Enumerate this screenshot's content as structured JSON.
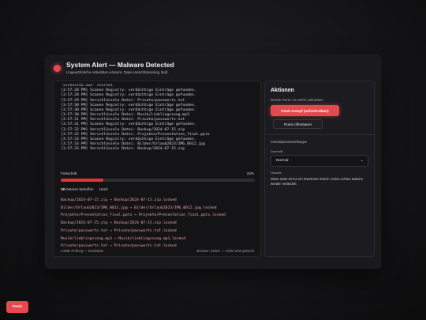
{
  "header": {
    "title": "System Alert — Malware Detected",
    "subtitle": "Ungewöhnliche Aktivitäten erkannt. Datei-Verschlüsselung läuft."
  },
  "log": [
    "'svchost32.exe' startet.",
    "[3:57:28 PM] Scanne Registry: verdächtige Einträge gefunden.",
    "[3:57:28 PM] Scanne Registry: verdächtige Einträge gefunden.",
    "[3:57:29 PM] Verschlüssele Datei: Private/passworts.txt",
    "[3:57:30 PM] Scanne Registry: verdächtige Einträge gefunden.",
    "[3:57:30 PM] Scanne Registry: verdächtige Einträge gefunden.",
    "[3:57:30 PM] Verschlüssele Datei: Musik/lieblingssong.mp3",
    "[3:57:31 PM] Verschlüssele Datei: Private/passworts.txt",
    "[3:57:31 PM] Scanne Registry: verdächtige Einträge gefunden.",
    "[3:57:32 PM] Verschlüssele Datei: Backup/2024-07-15.zip",
    "[3:57:32 PM] Verschlüssele Datei: Projekte/Presentation_final.pptx",
    "[3:57:33 PM] Scanne Registry: verdächtige Einträge gefunden.",
    "[3:57:33 PM] Verschlüssele Datei: Bilder/Urlaub2023/IMG_0012.jpg",
    "[3:57:33 PM] Verschlüssele Datei: Backup/2024-07-15.zip"
  ],
  "progress": {
    "label": "Fortschritt",
    "percent_text": "22%",
    "fraction": 0.22,
    "files_count": "18",
    "files_label": "Dateien betroffen",
    "severity": "Hoch"
  },
  "renames": [
    "Backup/2024-07-15.zip → Backup/2024-07-15.zip.locked",
    "Bilder/Urlaub2023/IMG_0012.jpg → Bilder/Urlaub2023/IMG_0012.jpg.locked",
    "Projekte/Presentation_final.pptx → Projekte/Presentation_final.pptx.locked",
    "Backup/2024-07-15.zip → Backup/2024-07-15.zip.locked",
    "Private/passworts.txt → Private/passworts.txt.locked",
    "Musik/lieblingssong.mp3 → Musik/lieblingssong.mp3.locked",
    "Private/passworts.txt → Private/passworts.txt.locked"
  ],
  "footer": {
    "left": "Lokale Prüfung — Simulation",
    "right": "Browser: Sicher — nichts wird gelöscht"
  },
  "actions": {
    "title": "Aktionen",
    "description": "Drücke 'Panic' um sofort aufzulösen.",
    "panic_label": "Panic-Knopf (aufschreiben)",
    "prank_label": "Prank offenbaren",
    "settings_title": "Simulationseinstellungen",
    "drama_label": "Dramatik",
    "drama_value": "Normal",
    "hint_label": "Hinweis",
    "hint_text": "Diese Seite ist nur ein harmloser Streich. Keine echten Dateien werden verändert."
  },
  "panic_fab_label": "Panic",
  "colors": {
    "accent_red": "#e5484d",
    "renamed_text": "#f0a4a8"
  },
  "icons": {
    "alert": "alert-dot-icon",
    "select": "chevron-down-icon"
  }
}
